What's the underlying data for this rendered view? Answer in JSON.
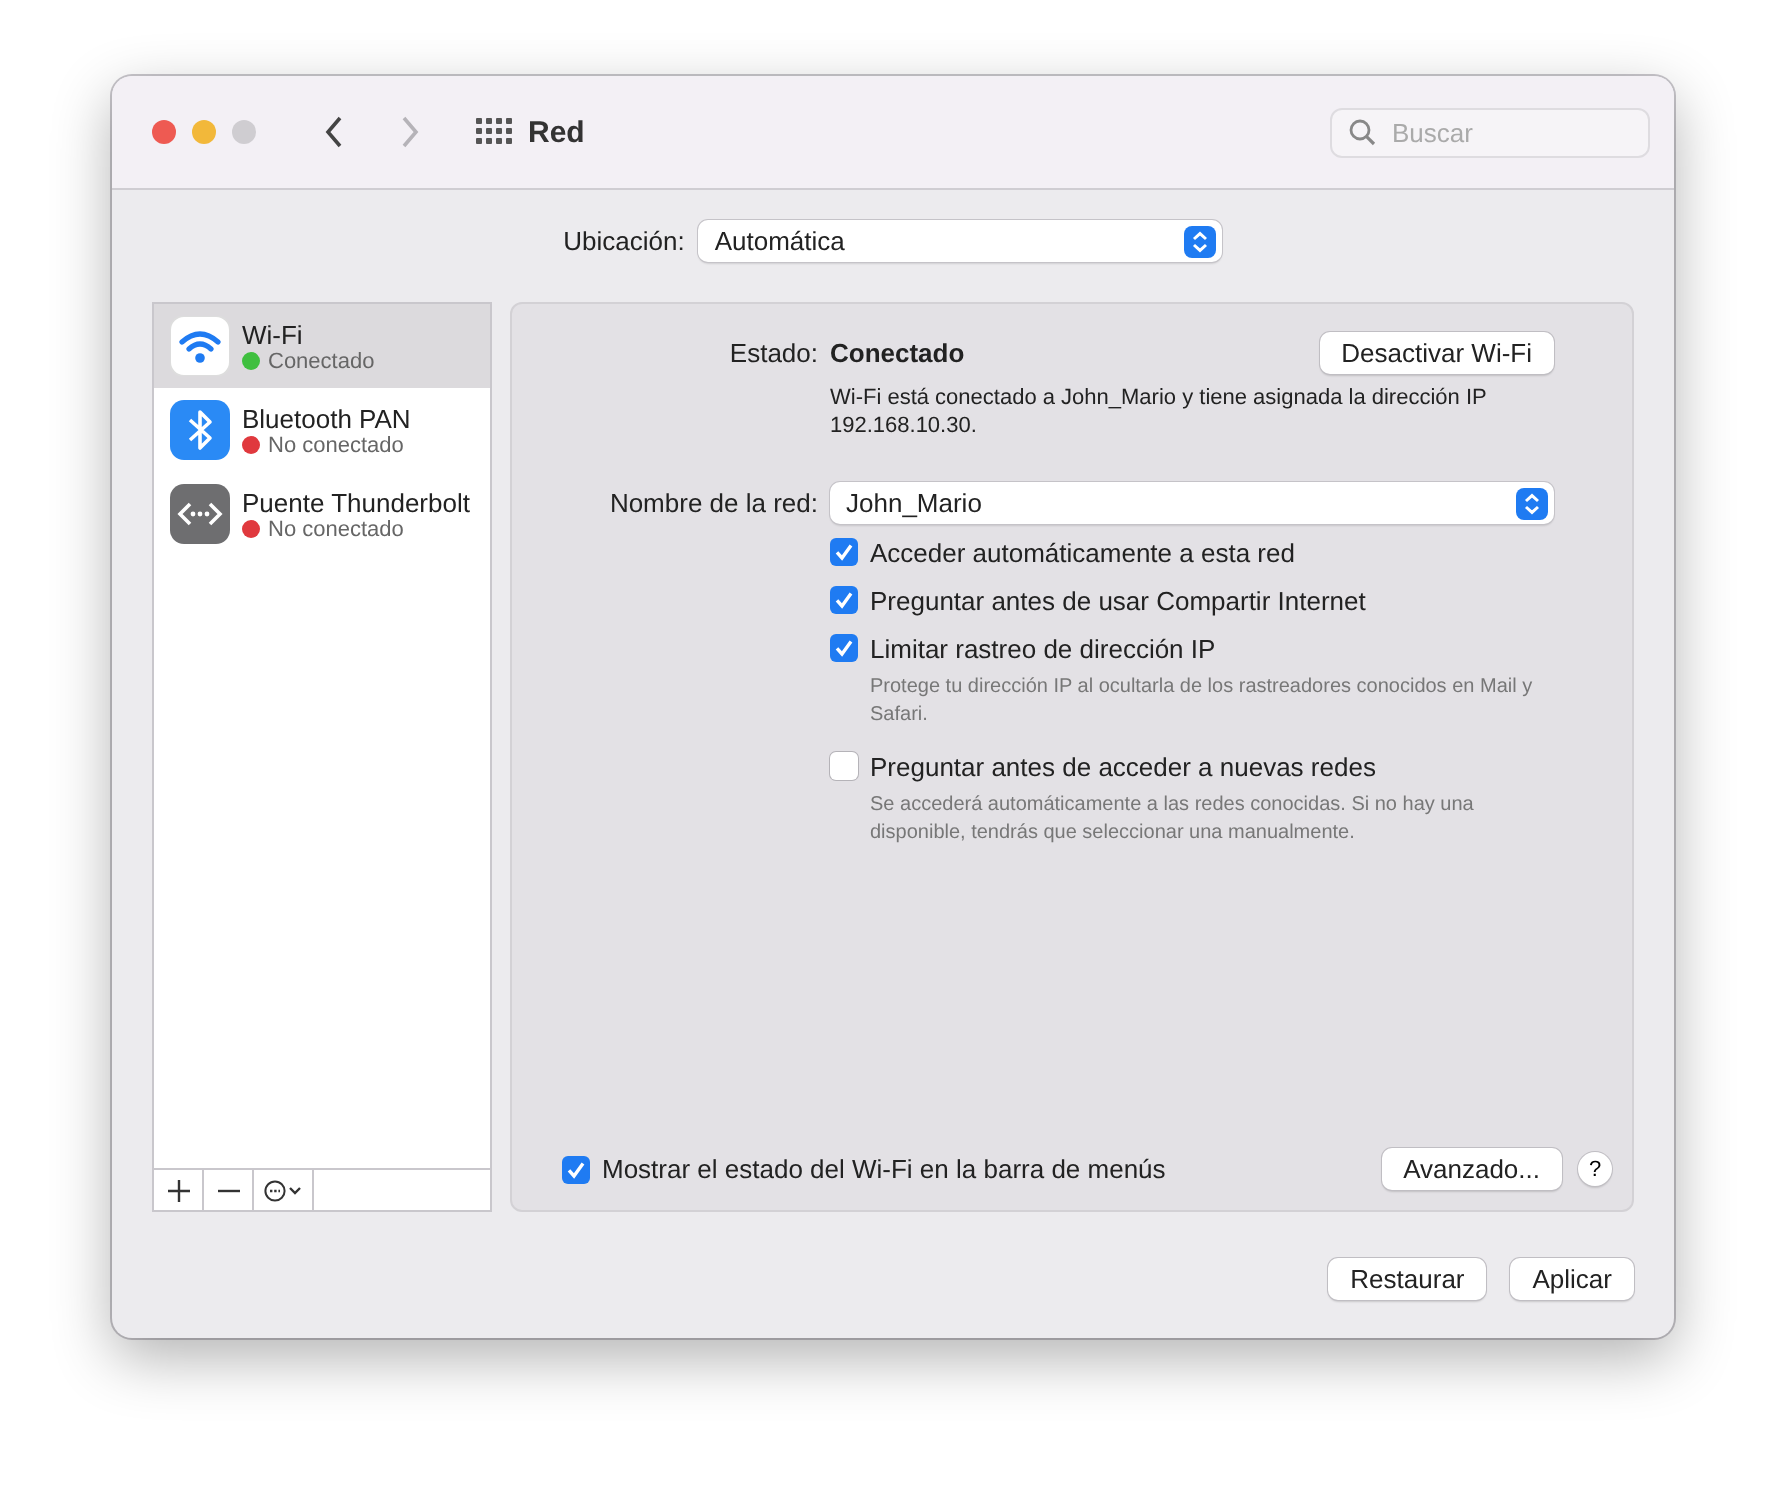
{
  "window": {
    "title": "Red",
    "zoom_disabled": true
  },
  "nav": {
    "back_disabled": false,
    "forward_disabled": true
  },
  "search": {
    "placeholder": "Buscar"
  },
  "location": {
    "label": "Ubicación:",
    "value": "Automática"
  },
  "services": [
    {
      "kind": "wifi",
      "name": "Wi-Fi",
      "status": "Conectado",
      "color": "#3fbf3f",
      "selected": true
    },
    {
      "kind": "bluetooth",
      "name": "Bluetooth PAN",
      "status": "No conectado",
      "color": "#e0393e",
      "selected": false
    },
    {
      "kind": "thunderbolt",
      "name": "Puente Thunderbolt",
      "status": "No conectado",
      "color": "#e0393e",
      "selected": false
    }
  ],
  "detail": {
    "status_label": "Estado:",
    "status_value": "Conectado",
    "toggle_button": "Desactivar Wi-Fi",
    "status_description": "Wi-Fi está conectado a John_Mario y tiene asignada la dirección IP 192.168.10.30.",
    "network_label": "Nombre de la red:",
    "network_value": "John_Mario",
    "options": [
      {
        "label": "Acceder automáticamente a esta red",
        "checked": true
      },
      {
        "label": "Preguntar antes de usar Compartir Internet",
        "checked": true
      },
      {
        "label": "Limitar rastreo de dirección IP",
        "checked": true,
        "note": "Protege tu dirección IP al ocultarla de los rastreadores conocidos en Mail y Safari."
      },
      {
        "label": "Preguntar antes de acceder a nuevas redes",
        "checked": false,
        "note": "Se accederá automáticamente a las redes conocidas. Si no hay una disponible, tendrás que seleccionar una manualmente."
      }
    ],
    "menu_bar_option": {
      "label": "Mostrar el estado del Wi-Fi en la barra de menús",
      "checked": true
    },
    "advanced_button": "Avanzado...",
    "help_button": "?"
  },
  "footer_buttons": [
    "Restaurar",
    "Aplicar"
  ]
}
